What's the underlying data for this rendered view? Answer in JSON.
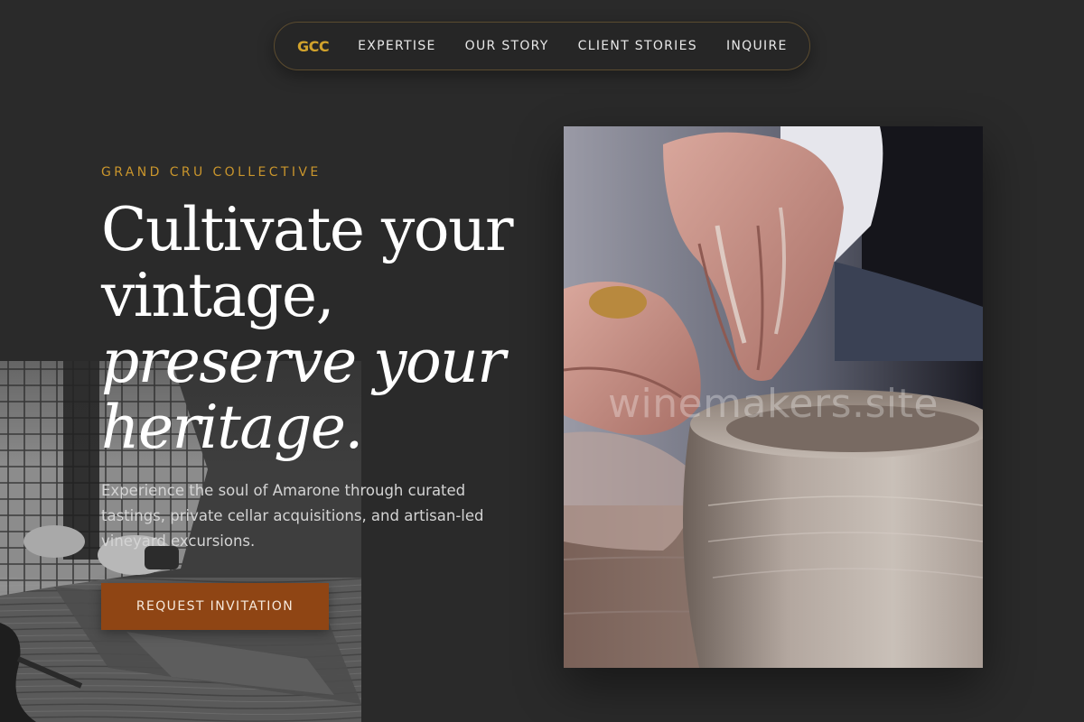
{
  "nav": {
    "logo": "GCC",
    "links": [
      "EXPERTISE",
      "OUR STORY",
      "CLIENT STORIES",
      "INQUIRE"
    ]
  },
  "hero": {
    "eyebrow": "GRAND CRU COLLECTIVE",
    "headline_lines": [
      "Cultivate your",
      "vintage,",
      "preserve your",
      "heritage."
    ],
    "lede": "Experience the soul of Amarone through curated tastings, private cellar acquisitions, and artisan-led vineyard excursions.",
    "cta_label": "REQUEST INVITATION"
  },
  "images": {
    "left_background": "tailor-cutting-fabric-photo",
    "right_feature": "pottery-wheel-hands-photo",
    "watermark": "winemakers.site"
  },
  "colors": {
    "background": "#2a2a2a",
    "accent_gold": "#c9952c",
    "cta_brown": "#8f4514"
  }
}
